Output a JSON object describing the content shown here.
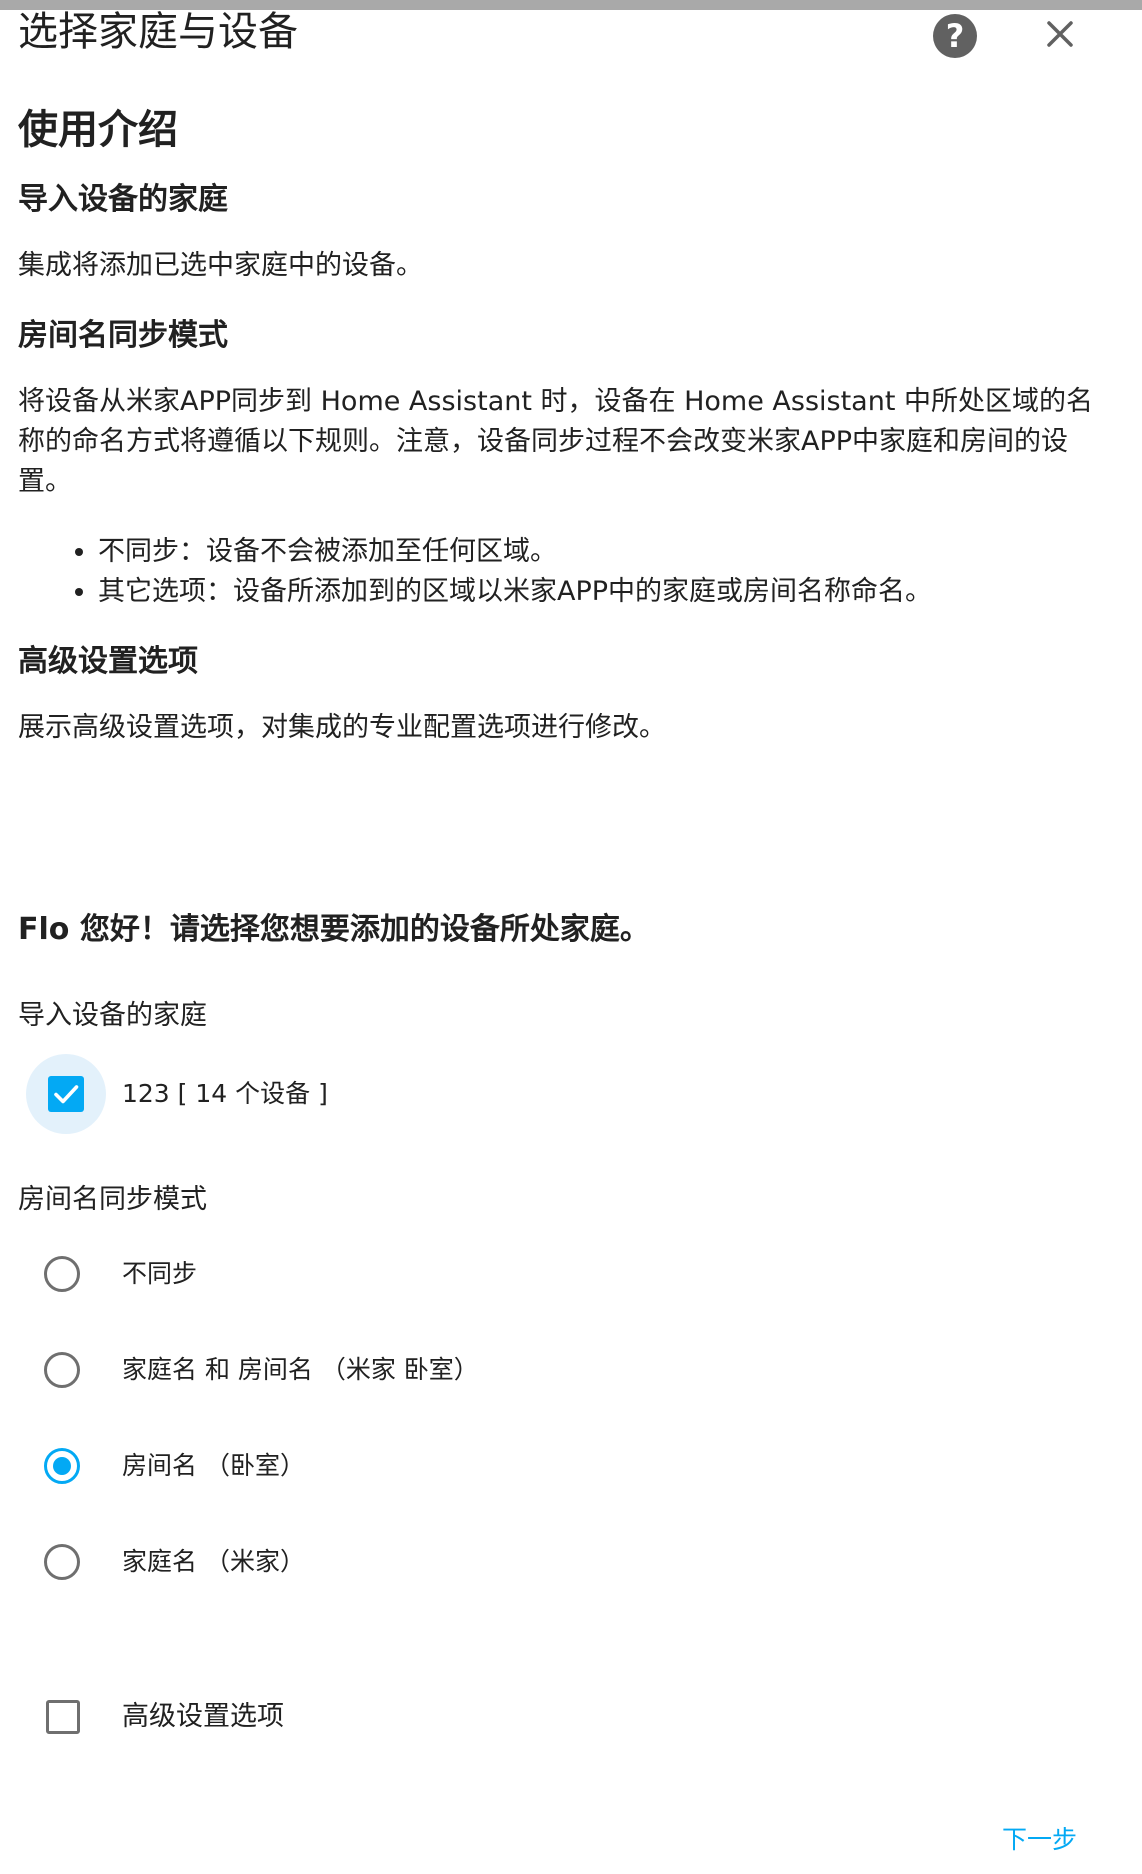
{
  "dialog": {
    "title": "选择家庭与设备",
    "help_icon": "help-circle-icon",
    "help_glyph": "?",
    "close_icon": "close-icon"
  },
  "intro": {
    "heading": "使用介绍",
    "home_heading": "导入设备的家庭",
    "home_text": "集成将添加已选中家庭中的设备。",
    "sync_heading": "房间名同步模式",
    "sync_text": "将设备从米家APP同步到 Home Assistant 时，设备在 Home Assistant 中所处区域的名称的命名方式将遵循以下规则。注意，设备同步过程不会改变米家APP中家庭和房间的设置。",
    "sync_rules": [
      "不同步：设备不会被添加至任何区域。",
      "其它选项：设备所添加到的区域以米家APP中的家庭或房间名称命名。"
    ],
    "advanced_heading": "高级设置选项",
    "advanced_text": "展示高级设置选项，对集成的专业配置选项进行修改。"
  },
  "form": {
    "greeting": "Flo 您好！请选择您想要添加的设备所处家庭。",
    "home_field_label": "导入设备的家庭",
    "homes": [
      {
        "label": "123 [ 14 个设备 ]",
        "checked": true
      }
    ],
    "sync_field_label": "房间名同步模式",
    "sync_options": [
      {
        "label": "不同步",
        "selected": false
      },
      {
        "label": "家庭名 和 房间名 （米家 卧室）",
        "selected": false
      },
      {
        "label": "房间名 （卧室）",
        "selected": true
      },
      {
        "label": "家庭名 （米家）",
        "selected": false
      }
    ],
    "advanced_label": "高级设置选项",
    "advanced_checked": false,
    "next_label": "下一步"
  },
  "colors": {
    "accent": "#03a9f4",
    "text": "#212121",
    "control_border": "#6f6f6f",
    "checkbox_halo": "#e3f1fb",
    "top_strip": "#a9a9a9"
  }
}
